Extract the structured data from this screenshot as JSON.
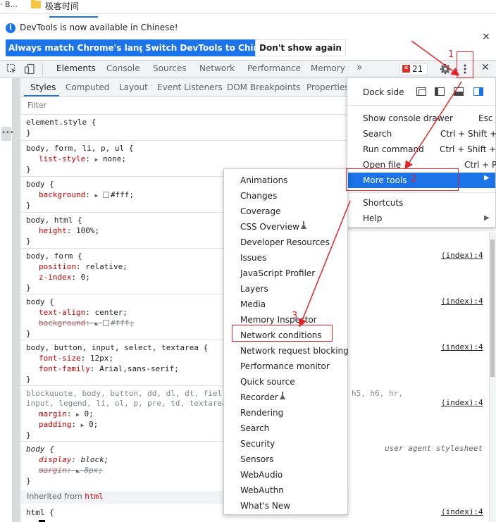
{
  "bookmarks": {
    "left_label": "· B...",
    "folder_label": "极客时间"
  },
  "infobar": {
    "message": "DevTools is now available in Chinese!",
    "buttons": {
      "match_language": "Always match Chrome's language",
      "switch_chinese": "Switch DevTools to Chinese",
      "dont_show": "Don't show again"
    },
    "close": "×"
  },
  "main_tabs": [
    "Elements",
    "Console",
    "Sources",
    "Network",
    "Performance",
    "Memory"
  ],
  "more_tabs": "»",
  "error_count": "21",
  "close_devtools": "✕",
  "sub_tabs": [
    "Styles",
    "Computed",
    "Layout",
    "Event Listeners",
    "DOM Breakpoints",
    "Properties"
  ],
  "filter": {
    "placeholder": "Filter"
  },
  "css_rules": {
    "r0": {
      "selector": "element.style {",
      "close": "}"
    },
    "r1": {
      "selector": "body, form, li, p, ul {",
      "prop": "list-style",
      "value": "none;",
      "close": "}"
    },
    "r2": {
      "selector": "body {",
      "prop": "background",
      "value": "#fff;",
      "close": "}"
    },
    "r3": {
      "selector": "body, html {",
      "prop": "height",
      "value": "100%;",
      "close": "}"
    },
    "r4": {
      "selector": "body, form {",
      "prop1": "position",
      "value1": "relative;",
      "prop2": "z-index",
      "value2": "0;",
      "close": "}",
      "source": "(index):4"
    },
    "r5": {
      "selector": "body {",
      "prop1": "text-align",
      "value1": "center;",
      "prop2": "background",
      "value2": "#fff;",
      "close": "}",
      "source": "(index):4"
    },
    "r6": {
      "selector": "body, button, input, select, textarea {",
      "prop1": "font-size",
      "value1": "12px;",
      "prop2": "font-family",
      "value2": "Arial,sans-serif;",
      "close": "}",
      "source": "(index):4"
    },
    "r7": {
      "selector_a": "blockquote, body, button, dd, dl, dt, fiel",
      "selector_b": "h5, h6, hr,",
      "selector_c": "input, legend, li, ol, p, pre, td, textarea",
      "prop1": "margin",
      "value1": "0;",
      "prop2": "padding",
      "value2": "0;",
      "close": "}",
      "source": "(index):4"
    },
    "r8": {
      "selector": "body {",
      "prop1": "display",
      "value1": "block;",
      "prop2": "margin",
      "value2": "8px;",
      "close": "}",
      "source": "user agent stylesheet"
    },
    "r9": {
      "selector": "html {",
      "source": "(index):4"
    }
  },
  "inherited": {
    "label": "Inherited from",
    "tag": "html"
  },
  "main_menu": {
    "dock_side": "Dock side",
    "items": [
      {
        "label": "Show console drawer",
        "shortcut": "Esc"
      },
      {
        "label": "Search",
        "shortcut": "Ctrl + Shift + F"
      },
      {
        "label": "Run command",
        "shortcut": "Ctrl + Shift + P"
      },
      {
        "label": "Open file",
        "shortcut": "Ctrl + P"
      },
      {
        "label": "More tools",
        "shortcut": ""
      },
      {
        "label": "Shortcuts",
        "shortcut": ""
      },
      {
        "label": "Help",
        "shortcut": ""
      }
    ]
  },
  "more_tools_menu": [
    "Animations",
    "Changes",
    "Coverage",
    "CSS Overview",
    "Developer Resources",
    "Issues",
    "JavaScript Profiler",
    "Layers",
    "Media",
    "Memory Inspector",
    "Network conditions",
    "Network request blocking",
    "Performance monitor",
    "Quick source",
    "Recorder",
    "Rendering",
    "Search",
    "Security",
    "Sensors",
    "WebAudio",
    "WebAuthn",
    "What's New"
  ],
  "annotations": {
    "step1": "1",
    "step2": "2",
    "step3": "3"
  },
  "colors": {
    "accent": "#1a73e8",
    "annotation_red": "#e0262a",
    "error_red": "#d93025"
  }
}
